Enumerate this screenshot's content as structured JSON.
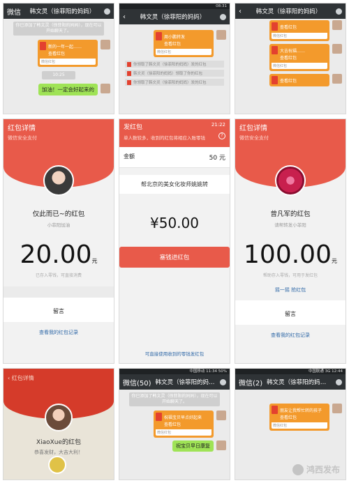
{
  "tile1": {
    "back": "微信",
    "title": "韩文灵（徐菲阳的妈妈）",
    "sys_text": "你已添加了韩文灵（徐菲阳的妈妈），现在可以开始聊天了。",
    "packet_text": "新的一年一起……",
    "packet_label": "查看红包",
    "packet_footer": "微信红包",
    "time": "10:25",
    "message": "加油！一定会好起来的"
  },
  "tile2": {
    "title": "韩文灵（徐菲阳的妈妈）",
    "time": "08:31",
    "packet_text": "周小鹏转发",
    "packet_label": "查看红包",
    "packet_footer": "微信红包",
    "sysline1": "你领取了韩文灵（徐菲阳的妈妈）发的红包",
    "sysline2": "韩文灵（徐菲阳的妈妈）领取了你的红包"
  },
  "tile3": {
    "title": "韩文灵（徐菲阳的妈妈）",
    "packet_text": "大吉祝福……",
    "packet_label": "查看红包",
    "packet_footer": "微信红包"
  },
  "tile4": {
    "header": "红包详情",
    "sub": "微信安全支付",
    "name": "仅此而已~的红包",
    "from": "小菲阳加油",
    "amount": "20.00",
    "unit": "元",
    "note": "已存入零钱，可直接消费",
    "msg": "留言",
    "link": "查看我的红包记录"
  },
  "tile5": {
    "header": "发红包",
    "time": "21:22",
    "sub": "单人数较多，收到的红包将相应入账零钱",
    "help": "?",
    "field_label": "金额",
    "field_value": "50 元",
    "note": "帮北京的美女化妆师姚姚转",
    "amount": "¥50.00",
    "button": "塞钱进红包",
    "foot": "可直接使用收到的零钱发红包"
  },
  "tile6": {
    "header": "红包详情",
    "sub": "微信安全支付",
    "name": "曾凡军的红包",
    "from": "请帮转发小菲阳",
    "amount": "100.00",
    "unit": "元",
    "note": "帮助存入零钱，可用于发红包",
    "link2": "摇一摇 抢红包",
    "msg": "留言",
    "link": "查看我的红包记录"
  },
  "tile7": {
    "header": "红包详情",
    "name": "XiaoXue的红包",
    "sub": "恭喜发财，大吉大利！"
  },
  "tile8": {
    "status": "中国移动 11:34 50%",
    "back": "微信(50)",
    "title": "韩文灵（徐菲阳的妈妈）",
    "sys_text": "你已添加了韩文灵（徐菲阳的妈妈），现在可以开始聊天了。",
    "packet_text": "祝福宝贝早点好起来",
    "packet_label": "查看红包",
    "packet_footer": "微信红包",
    "message": "祝宝贝早日康复"
  },
  "tile9": {
    "status": "中国联通 3G 12:44",
    "back": "微信(2)",
    "title": "韩文灵（徐菲阳的妈妈）",
    "packet_text": "朋友让我帮忙转的孩子",
    "packet_label": "查看红包",
    "packet_footer": "微信红包",
    "watermark": "鸿西发布"
  }
}
